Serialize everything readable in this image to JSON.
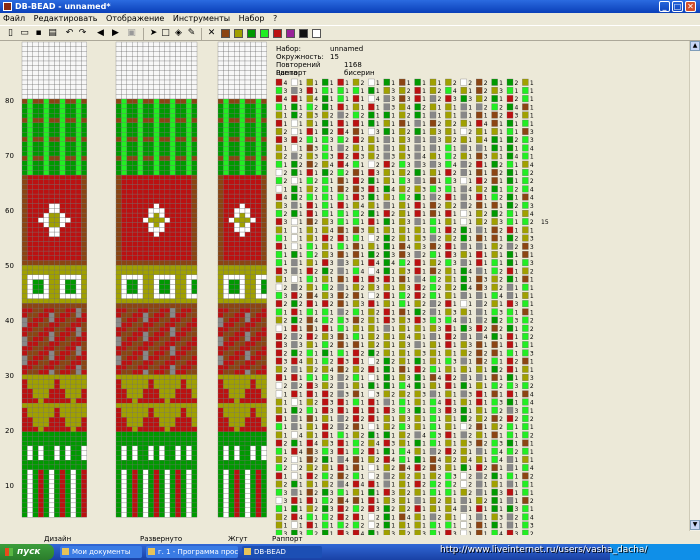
{
  "window": {
    "title": "DB-BEAD - unnamed*",
    "minimize": "_",
    "maximize": "□",
    "close": "✕"
  },
  "menu": [
    "Файл",
    "Редактировать",
    "Отображение",
    "Инструменты",
    "Набор",
    "?"
  ],
  "toolbar": {
    "icons": [
      "new-file-icon",
      "open-icon",
      "save-icon",
      "print-icon",
      "undo-icon",
      "redo-icon",
      "arrow-left-icon",
      "arrow-right-icon",
      "preview-icon",
      "pointer-icon",
      "select-rect-icon",
      "fill-icon",
      "pipette-icon",
      "clear-x-icon"
    ],
    "palette": [
      "#8b4513",
      "#a0a000",
      "#009900",
      "#22ee22",
      "#bb1111",
      "#992299",
      "#111111",
      "#ffffff"
    ]
  },
  "ruler": [
    "80",
    "70",
    "60",
    "50",
    "40",
    "30",
    "20",
    "10"
  ],
  "panels": {
    "design": "Дизайн",
    "expanded": "Развернуто",
    "rope": "Жгут",
    "rapport": "Раппорт"
  },
  "info": {
    "set_label": "Набор:",
    "set_value": "unnamed",
    "circ_label": "Окружность:",
    "circ_value": "15",
    "repeat_label": "Повторений цвета:",
    "repeat_value": "1168 бисерин",
    "rapport_label": "Раппорт"
  },
  "colors": {
    "brown": "#8b4513",
    "red": "#bb1111",
    "olive": "#a0a000",
    "green": "#009900",
    "lime": "#22ee22",
    "grey": "#888888",
    "white": "#ffffff"
  },
  "rapport_last_value": "15",
  "taskbar": {
    "start": "пуск",
    "tasks": [
      "Мои документы",
      "г. 1 - Программа прос...",
      "DB-BEAD"
    ],
    "watermark": "http://www.liveinternet.ru/users/vasha_dacha/"
  }
}
